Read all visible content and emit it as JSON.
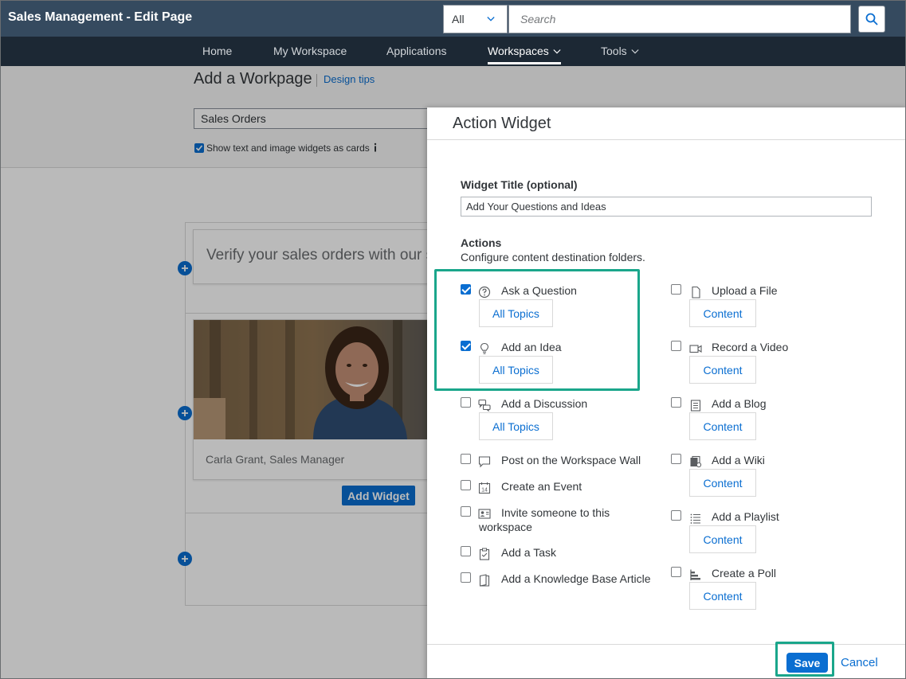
{
  "header": {
    "title": "Sales Management - Edit Page",
    "scope": "All",
    "search_placeholder": "Search"
  },
  "nav": {
    "items": [
      {
        "label": "Home"
      },
      {
        "label": "My Workspace"
      },
      {
        "label": "Applications"
      },
      {
        "label": "Workspaces"
      },
      {
        "label": "Tools"
      }
    ],
    "active": "Workspaces"
  },
  "page": {
    "title": "Add a Workpage",
    "design_tips": "Design tips",
    "workpage_name": "Sales Orders",
    "cards_checkbox_label": "Show text and image widgets as cards",
    "text_card": "Verify your sales orders with our s",
    "image_caption": "Carla Grant, Sales Manager",
    "add_widget": "Add Widget"
  },
  "dialog": {
    "title": "Action Widget",
    "widget_title_label": "Widget Title (optional)",
    "widget_title_value": "Add Your Questions and Ideas",
    "actions_label": "Actions",
    "actions_description": "Configure content destination folders.",
    "left_actions": [
      {
        "label": "Ask a Question",
        "checked": true,
        "icon": "question-circle-icon",
        "button": "All Topics"
      },
      {
        "label": "Add an Idea",
        "checked": true,
        "icon": "lightbulb-icon",
        "button": "All Topics"
      },
      {
        "label": "Add a Discussion",
        "checked": false,
        "icon": "discussion-icon",
        "button": "All Topics"
      },
      {
        "label": "Post on the Workspace Wall",
        "checked": false,
        "icon": "comment-icon"
      },
      {
        "label": "Create an Event",
        "checked": false,
        "icon": "calendar-icon",
        "icon_text": "14"
      },
      {
        "label": "Invite someone to this",
        "label2": "workspace",
        "checked": false,
        "icon": "invite-icon"
      },
      {
        "label": "Add a Task",
        "checked": false,
        "icon": "task-icon"
      },
      {
        "label": "Add a Knowledge Base Article",
        "checked": false,
        "icon": "article-icon"
      }
    ],
    "right_actions": [
      {
        "label": "Upload a File",
        "checked": false,
        "icon": "file-icon",
        "button": "Content"
      },
      {
        "label": "Record a Video",
        "checked": false,
        "icon": "video-icon",
        "button": "Content"
      },
      {
        "label": "Add a Blog",
        "checked": false,
        "icon": "blog-icon",
        "button": "Content"
      },
      {
        "label": "Add a Wiki",
        "checked": false,
        "icon": "wiki-icon",
        "button": "Content"
      },
      {
        "label": "Add a Playlist",
        "checked": false,
        "icon": "playlist-icon",
        "button": "Content"
      },
      {
        "label": "Create a Poll",
        "checked": false,
        "icon": "poll-icon",
        "button": "Content"
      }
    ],
    "save": "Save",
    "cancel": "Cancel"
  },
  "colors": {
    "header_bg": "#354a5f",
    "nav_bg": "#1c2834",
    "accent": "#0a6ed1",
    "highlight": "#1aa68b"
  }
}
